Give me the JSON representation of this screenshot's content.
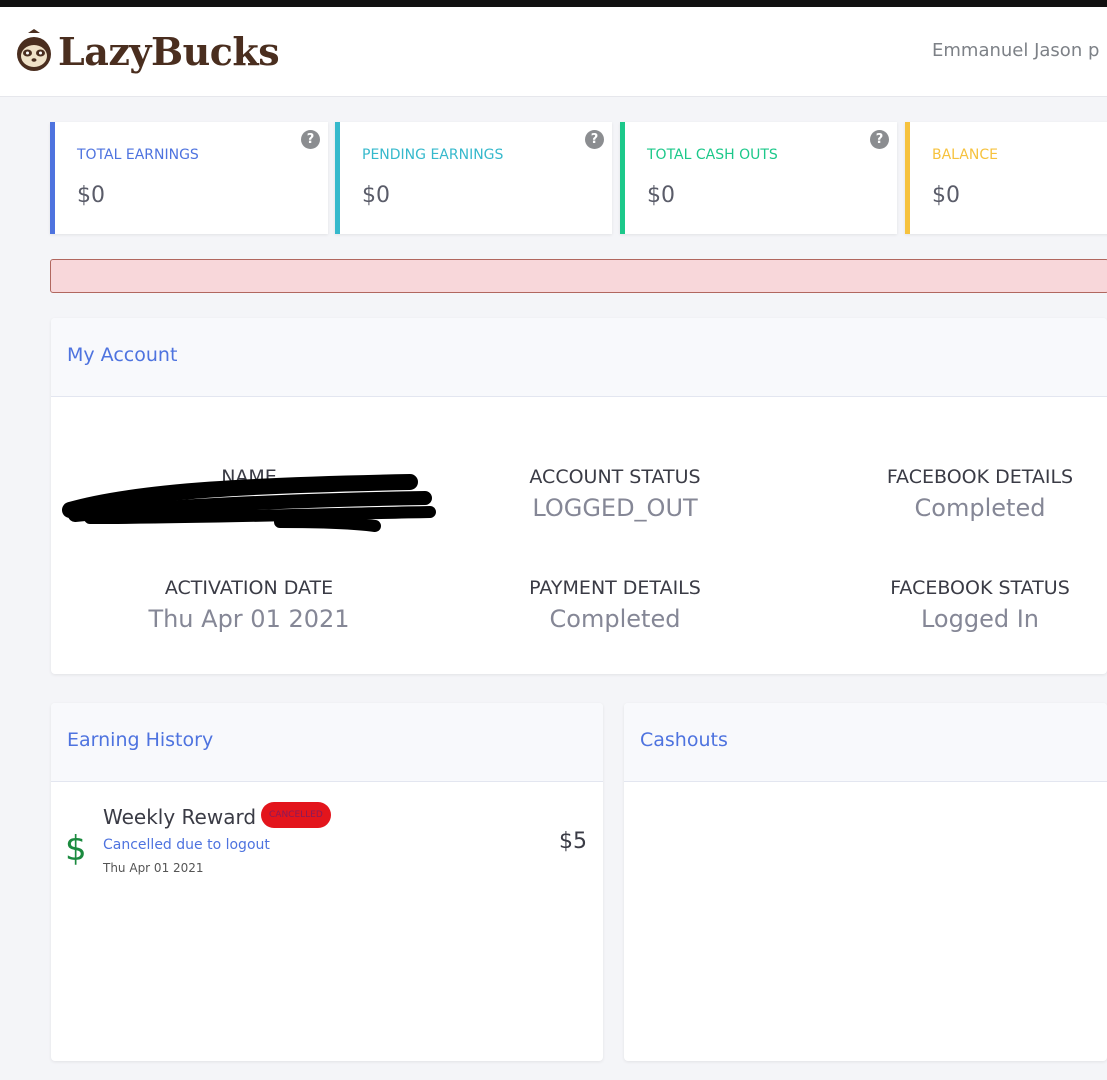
{
  "header": {
    "brand": "LazyBucks",
    "user": "Emmanuel Jason p"
  },
  "stats": [
    {
      "label": "TOTAL EARNINGS",
      "value": "$0",
      "color": "#4e73df"
    },
    {
      "label": "PENDING EARNINGS",
      "value": "$0",
      "color": "#36b9cc"
    },
    {
      "label": "TOTAL CASH OUTS",
      "value": "$0",
      "color": "#1cc88a"
    },
    {
      "label": "BALANCE",
      "value": "$0",
      "color": "#f6c23e"
    }
  ],
  "account": {
    "title": "My Account",
    "name_label": "NAME",
    "account_status_label": "ACCOUNT STATUS",
    "account_status_value": "LOGGED_OUT",
    "facebook_details_label": "FACEBOOK DETAILS",
    "facebook_details_value": "Completed",
    "activation_date_label": "ACTIVATION DATE",
    "activation_date_value": "Thu Apr 01 2021",
    "payment_details_label": "PAYMENT DETAILS",
    "payment_details_value": "Completed",
    "facebook_status_label": "FACEBOOK STATUS",
    "facebook_status_value": "Logged In"
  },
  "earning_history": {
    "title": "Earning History",
    "items": [
      {
        "title": "Weekly Reward",
        "badge": "CANCELLED",
        "note": "Cancelled due to logout",
        "date": "Thu Apr 01 2021",
        "amount": "$5"
      }
    ]
  },
  "cashouts": {
    "title": "Cashouts"
  },
  "colors": {
    "brand": "#4a2e1f",
    "primary": "#4e73df",
    "alert_bg": "#f8d7da",
    "badge": "#e3151c",
    "dollar": "#1b8a3f"
  },
  "icons": [
    "sloth-logo-icon",
    "help-icon",
    "dollar-icon"
  ]
}
